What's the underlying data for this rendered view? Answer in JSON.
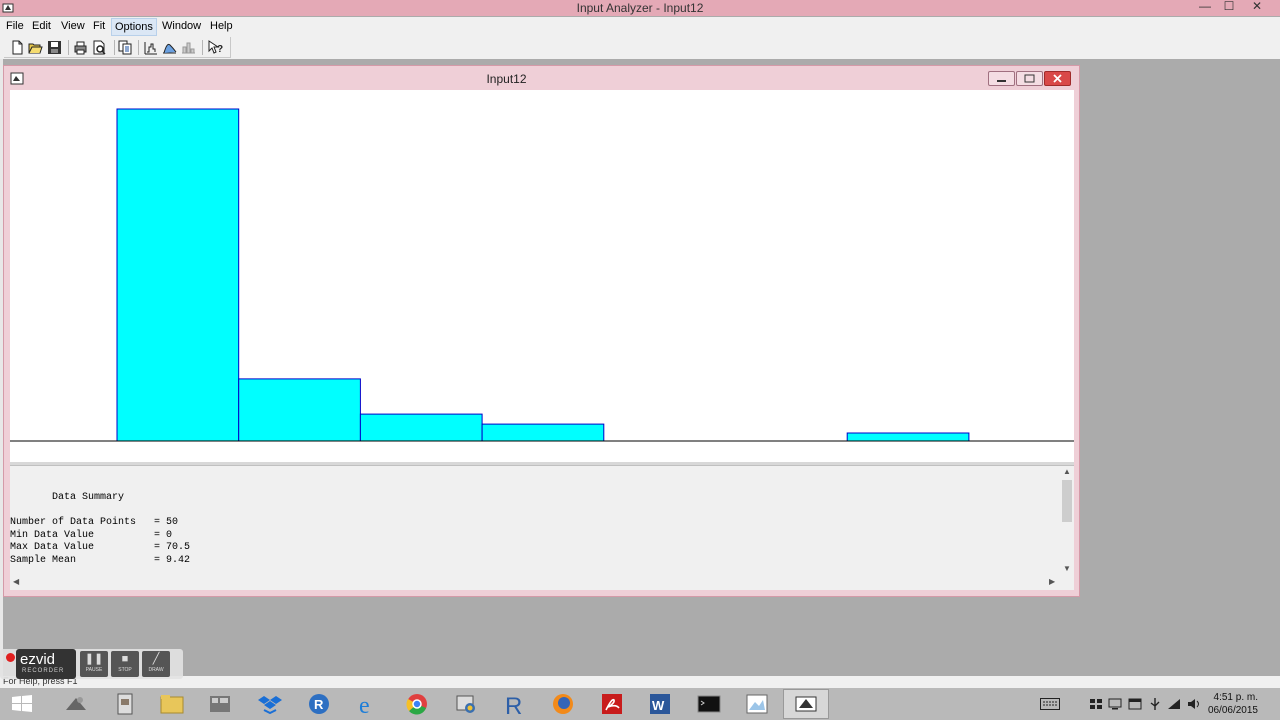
{
  "window": {
    "title": "Input Analyzer - Input12",
    "minimize": "—",
    "maximize": "☐",
    "close": "✕"
  },
  "menu": [
    "File",
    "Edit",
    "View",
    "Fit",
    "Options",
    "Window",
    "Help"
  ],
  "toolbar": {
    "icons": [
      "new-icon",
      "open-icon",
      "save-icon",
      "print-icon",
      "print-preview-icon",
      "copy-icon",
      "fit-icon",
      "distribution-icon",
      "histogram-icon",
      "context-help-icon"
    ]
  },
  "child_window": {
    "title": "Input12"
  },
  "chart_data": {
    "type": "bar",
    "title": "",
    "xlabel": "",
    "ylabel": "",
    "bins": [
      {
        "bin": 1,
        "relative_height": 1.0
      },
      {
        "bin": 2,
        "relative_height": 0.187
      },
      {
        "bin": 3,
        "relative_height": 0.081
      },
      {
        "bin": 4,
        "relative_height": 0.051
      },
      {
        "bin": 5,
        "relative_height": 0.0
      },
      {
        "bin": 6,
        "relative_height": 0.0
      },
      {
        "bin": 7,
        "relative_height": 0.024
      }
    ],
    "bar_color": "#00ffff",
    "grid": false
  },
  "summary": {
    "heading": "Data Summary",
    "rows": [
      {
        "label": "Number of Data Points",
        "value": "50"
      },
      {
        "label": "Min Data Value",
        "value": "0"
      },
      {
        "label": "Max Data Value",
        "value": "70.5"
      },
      {
        "label": "Sample Mean",
        "value": "9.42"
      }
    ]
  },
  "status": {
    "text": "For Help, press F1"
  },
  "recorder": {
    "logo": "ezvid",
    "sub": "RECORDER",
    "pause": "PAUSE",
    "stop": "STOP",
    "draw": "DRAW"
  },
  "taskbar": {
    "apps": [
      "start-icon",
      "app-icon",
      "file-icon",
      "folder-icon",
      "app-icon",
      "dropbox-icon",
      "r-icon",
      "internet-explorer-icon",
      "chrome-icon",
      "python-icon",
      "rstudio-icon",
      "firefox-icon",
      "acrobat-icon",
      "word-icon",
      "terminal-icon",
      "paint-icon",
      "input-analyzer-icon"
    ],
    "clock_time": "4:51 p. m.",
    "clock_date": "06/06/2015"
  },
  "colors": {
    "title_bar": "#e4a9b6",
    "child_frame": "#efcfd7",
    "histogram_fill": "#00ffff"
  }
}
